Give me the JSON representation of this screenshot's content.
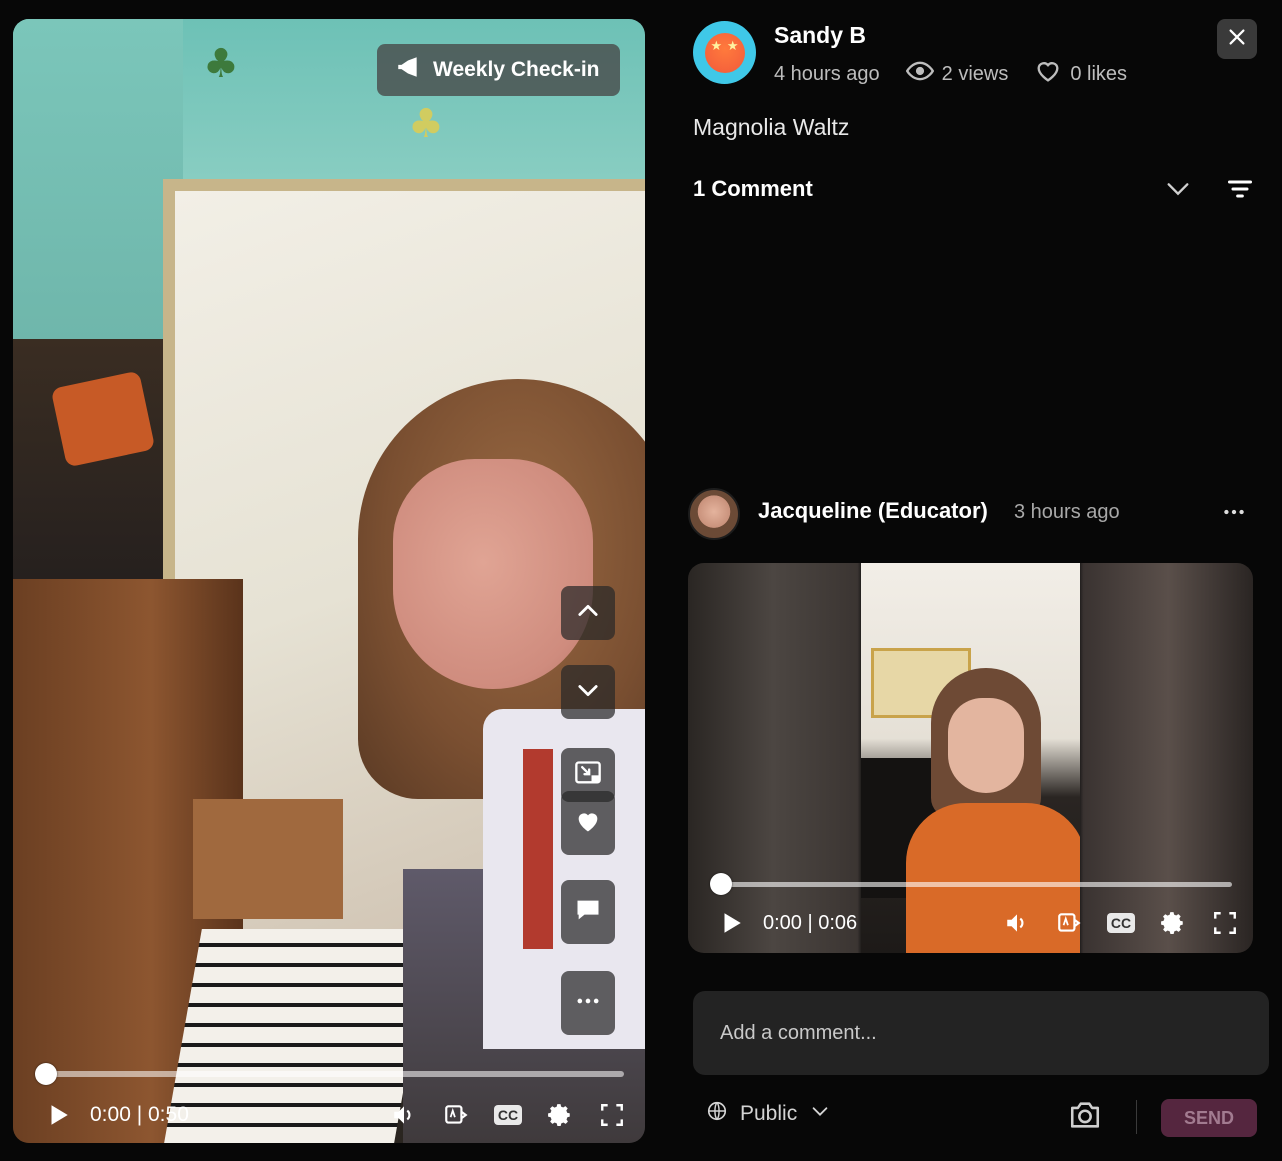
{
  "post": {
    "tag": "Weekly Check-in",
    "author": "Sandy B",
    "time_ago": "4 hours ago",
    "views": "2 views",
    "likes": "0 likes",
    "title": "Magnolia Waltz"
  },
  "player": {
    "time": "0:00 | 0:50",
    "progress": 0.0,
    "cc_label": "CC"
  },
  "comments": {
    "count_label": "1 Comment",
    "items": [
      {
        "author": "Jacqueline (Educator)",
        "time_ago": "3 hours ago",
        "video_time": "0:00 | 0:06",
        "video_progress": 0.0,
        "cc_label": "CC"
      }
    ]
  },
  "composer": {
    "placeholder": "Add a comment...",
    "visibility": "Public",
    "send_label": "SEND"
  },
  "colors": {
    "background": "#070707",
    "send_button": "#55263f",
    "avatar_ring": "#3fc8e8"
  },
  "icons": {
    "tag": "megaphone-icon",
    "views": "eye-icon",
    "likes": "heart-outline-icon",
    "close": "close-icon",
    "sort": "chevron-down-icon",
    "filter": "filter-icon",
    "visibility": "globe-icon",
    "camera": "camera-icon"
  }
}
